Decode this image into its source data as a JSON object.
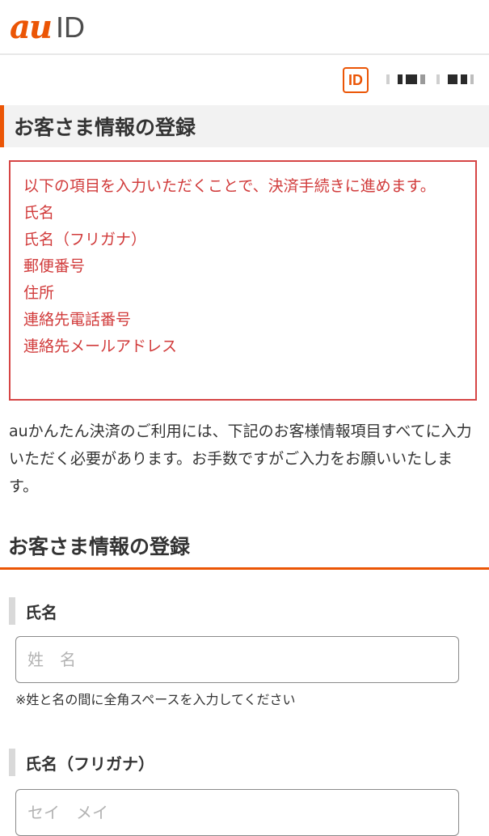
{
  "header": {
    "logo_brand": "au",
    "logo_suffix": "ID"
  },
  "account": {
    "badge": "ID"
  },
  "page_title": "お客さま情報の登録",
  "notice": {
    "lines": [
      "以下の項目を入力いただくことで、決済手続きに進めます。",
      "氏名",
      "氏名（フリガナ）",
      "郵便番号",
      "住所",
      "連絡先電話番号",
      "連絡先メールアドレス"
    ]
  },
  "description": "auかんたん決済のご利用には、下記のお客様情報項目すべてに入力いただく必要があります。お手数ですがご入力をお願いいたします。",
  "form": {
    "title": "お客さま情報の登録",
    "name": {
      "label": "氏名",
      "placeholder": "姓　名",
      "value": "",
      "hint": "※姓と名の間に全角スペースを入力してください"
    },
    "kana": {
      "label": "氏名（フリガナ）",
      "placeholder": "セイ　メイ",
      "value": ""
    }
  },
  "colors": {
    "brand": "#eb5505",
    "notice_red": "#d13b3b",
    "text": "#333333"
  }
}
